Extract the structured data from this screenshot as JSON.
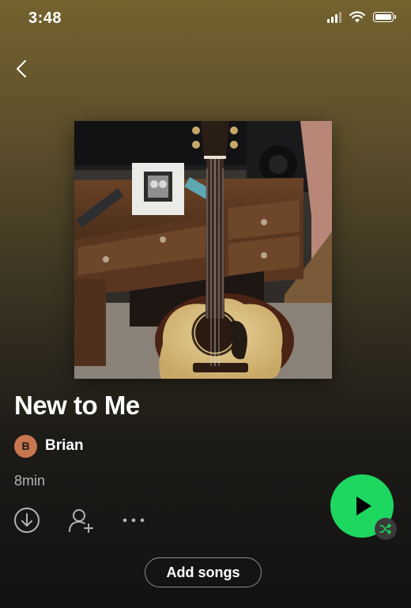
{
  "status_bar": {
    "time": "3:48",
    "icons": [
      "signal-icon",
      "wifi-icon",
      "battery-icon"
    ]
  },
  "navigation": {
    "back_icon": "chevron-left-icon"
  },
  "playlist": {
    "title": "New to Me",
    "cover_description_icon": "album-cover-guitar",
    "owner": {
      "avatar_initial": "B",
      "avatar_color": "#c7764f",
      "name": "Brian"
    },
    "duration": "8min"
  },
  "actions": {
    "icons": [
      "download-icon",
      "add-user-icon",
      "more-options-icon"
    ],
    "play_icon": "play-icon",
    "shuffle_icon": "shuffle-icon",
    "add_songs_label": "Add songs"
  },
  "colors": {
    "accent": "#1ed760",
    "header_gradient_top": "#74622f",
    "background": "#121212",
    "secondary_text": "#b3b3b3"
  }
}
